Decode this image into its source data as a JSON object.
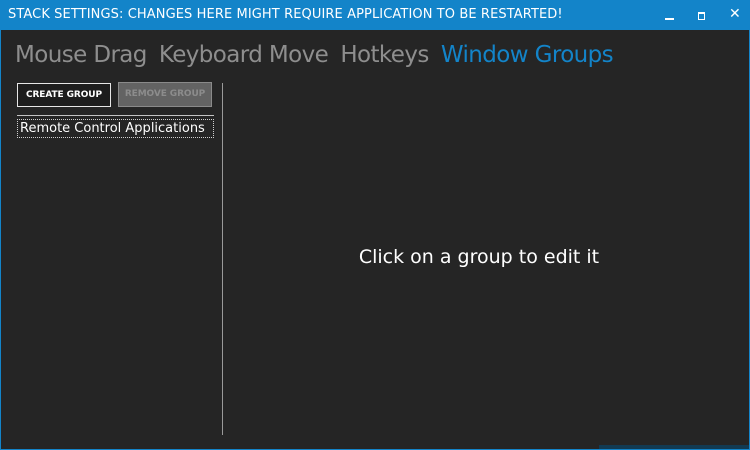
{
  "window": {
    "title": "STACK SETTINGS: CHANGES HERE MIGHT REQUIRE APPLICATION TO BE RESTARTED!",
    "controls": {
      "minimize": "minimize-icon",
      "maximize": "maximize-icon",
      "close": "close-icon",
      "close_glyph": "✕"
    }
  },
  "tabs": [
    {
      "label": "Mouse Drag",
      "active": false
    },
    {
      "label": "Keyboard Move",
      "active": false
    },
    {
      "label": "Hotkeys",
      "active": false
    },
    {
      "label": "Window Groups",
      "active": true
    }
  ],
  "sidebar": {
    "create_label": "CREATE GROUP",
    "remove_label": "REMOVE GROUP",
    "remove_enabled": false,
    "groups": [
      {
        "label": "Remote Control Applications"
      }
    ]
  },
  "main": {
    "placeholder": "Click on a group to edit it"
  },
  "colors": {
    "accent": "#1384c9",
    "background": "#252525",
    "inactive_tab": "#8e8e8e"
  }
}
